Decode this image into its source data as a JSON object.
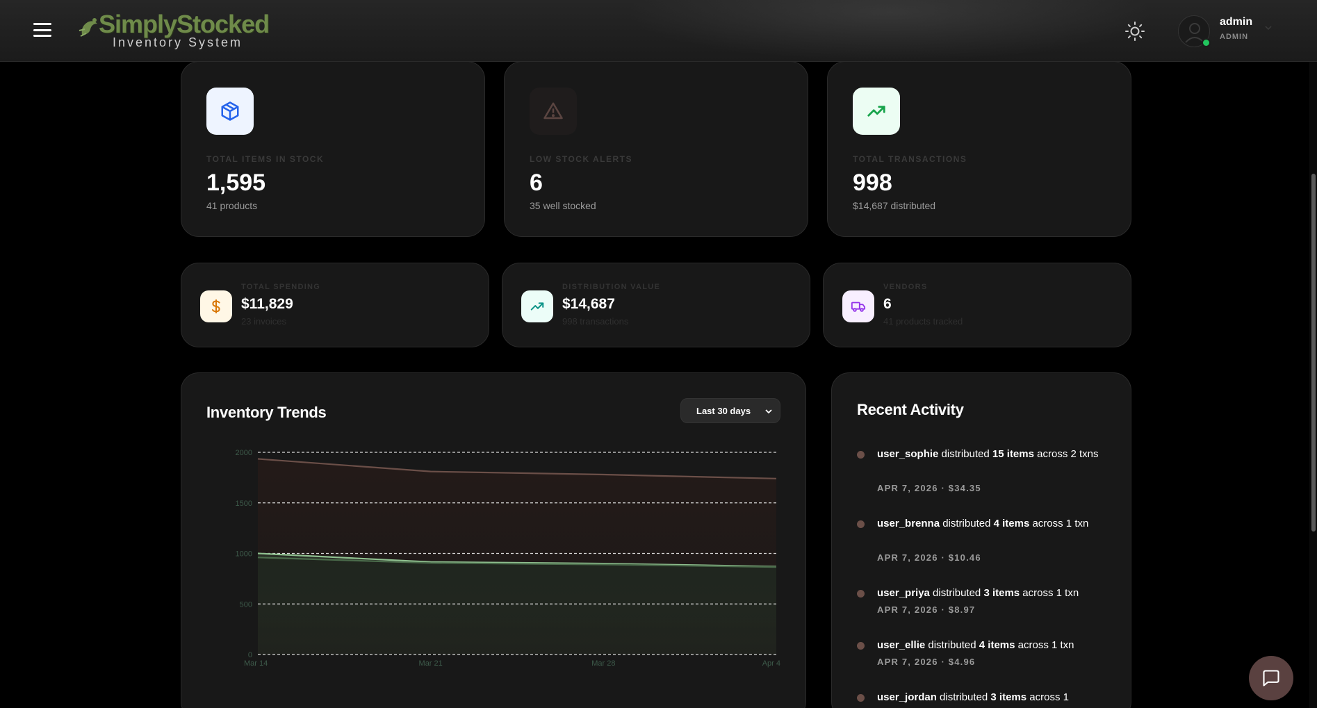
{
  "header": {
    "logo_title": "SimplyStocked",
    "logo_subtitle": "Inventory System",
    "user": {
      "name": "admin",
      "role": "ADMIN"
    }
  },
  "stats_top": [
    {
      "label": "TOTAL ITEMS IN STOCK",
      "value": "1,595",
      "sub": "41 products",
      "icon": "box-icon",
      "icon_bg": "#eef4ff",
      "icon_color": "#2563eb"
    },
    {
      "label": "LOW STOCK ALERTS",
      "value": "6",
      "sub": "35 well stocked",
      "icon": "warning-icon",
      "icon_bg": "#1f1c1c",
      "icon_color": "#5b4541"
    },
    {
      "label": "TOTAL TRANSACTIONS",
      "value": "998",
      "sub": "$14,687 distributed",
      "icon": "trending-up-icon",
      "icon_bg": "#ecfdf3",
      "icon_color": "#16a34a"
    }
  ],
  "stats_bottom": [
    {
      "label": "TOTAL SPENDING",
      "value": "$11,829",
      "sub": "23 invoices",
      "icon": "dollar-icon",
      "icon_bg": "#fff7e6",
      "icon_color": "#d97706"
    },
    {
      "label": "DISTRIBUTION VALUE",
      "value": "$14,687",
      "sub": "998 transactions",
      "icon": "trending-up-icon",
      "icon_bg": "#ecfdf8",
      "icon_color": "#0d9488"
    },
    {
      "label": "VENDORS",
      "value": "6",
      "sub": "41 products tracked",
      "icon": "truck-icon",
      "icon_bg": "#f8efff",
      "icon_color": "#9333ea"
    }
  ],
  "trends": {
    "title": "Inventory Trends",
    "range_label": "Last 30 days"
  },
  "chart_data": {
    "type": "area",
    "x": [
      "Mar 14",
      "Mar 21",
      "Mar 28",
      "Apr 4"
    ],
    "x_ticks": [
      "Mar 14",
      "Mar 21",
      "Mar 28",
      "Apr 4"
    ],
    "y_ticks": [
      0,
      500,
      1000,
      1500,
      2000
    ],
    "ylim": [
      0,
      2000
    ],
    "grid": true,
    "series": [
      {
        "values": [
          1935,
          1810,
          1780,
          1740
        ],
        "color": "#6b4f48",
        "fill": "#241a18"
      },
      {
        "values": [
          1000,
          915,
          900,
          870
        ],
        "color": "#8fbf8f",
        "fill": "#283026"
      },
      {
        "values": [
          960,
          905,
          890,
          865
        ],
        "color": "#4a6a4a",
        "fill": "#1f251e"
      }
    ]
  },
  "activity": {
    "title": "Recent Activity",
    "items": [
      {
        "user": "user_sophie",
        "verb": " distributed ",
        "qty": "15 items",
        "rest": " across 2 txns",
        "meta": "APR 7, 2026 · $34.35"
      },
      {
        "user": "user_brenna",
        "verb": " distributed ",
        "qty": "4 items",
        "rest": " across 1 txn",
        "meta": "APR 7, 2026 · $10.46"
      },
      {
        "user": "user_priya",
        "verb": " distributed ",
        "qty": "3 items",
        "rest": " across 1 txn",
        "meta": "APR 7, 2026 · $8.97"
      },
      {
        "user": "user_ellie",
        "verb": " distributed ",
        "qty": "4 items",
        "rest": " across 1 txn",
        "meta": "APR 7, 2026 · $4.96"
      },
      {
        "user": "user_jordan",
        "verb": " distributed ",
        "qty": "3 items",
        "rest": " across 1",
        "meta": ""
      }
    ]
  },
  "icons": {
    "menu": "hamburger-icon",
    "theme": "sun-icon",
    "chat": "chat-icon",
    "chevron": "chevron-down-icon"
  }
}
